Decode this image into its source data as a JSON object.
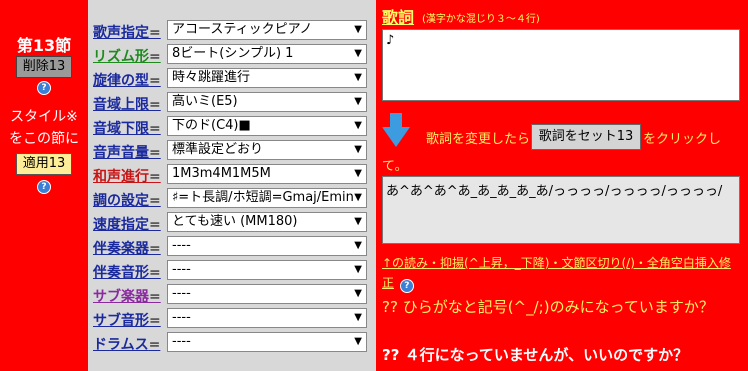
{
  "left": {
    "section_title": "第13節",
    "delete_button": "削除13",
    "style_note_line1": "スタイル※",
    "style_note_line2": "をこの節に",
    "apply_button": "適用13"
  },
  "form": {
    "rows": [
      {
        "label": "歌声指定",
        "value": "アコースティックピアノ"
      },
      {
        "label": "リズム形",
        "value": "8ビート(シンプル) 1"
      },
      {
        "label": "旋律の型",
        "value": "時々跳躍進行"
      },
      {
        "label": "音域上限",
        "value": "高いミ(E5)"
      },
      {
        "label": "音域下限",
        "value": "下のド(C4)■"
      },
      {
        "label": "音声音量",
        "value": "標準設定どおり"
      },
      {
        "label": "和声進行",
        "value": "1M3m4M1M5M"
      },
      {
        "label": "調の設定",
        "value": "♯=ト長調/ホ短調=Gmaj/Emin"
      },
      {
        "label": "速度指定",
        "value": "とても速い (MM180)"
      },
      {
        "label": "伴奏楽器",
        "value": "----"
      },
      {
        "label": "伴奏音形",
        "value": "----"
      },
      {
        "label": "サブ楽器",
        "value": "----"
      },
      {
        "label": "サブ音形",
        "value": "----"
      },
      {
        "label": "ドラムス",
        "value": "----"
      }
    ],
    "eq": "="
  },
  "lyrics": {
    "title": "歌詞",
    "subtitle": "(漢字かな混じり３～４行)",
    "text": "♪",
    "instruction_before": "歌詞を変更したら",
    "set_button": "歌詞をセット13",
    "instruction_after": "をクリックし",
    "instruction_te": "て。",
    "reading_text": "あ^あ^あ^あ_あ_あ_あ_あ/っっっっ/っっっっ/っっっっ/",
    "note": "↑の読み・抑揚(^上昇，_下降)・文節区切り(/)・全角空白挿入修正",
    "warning1": "?? ひらがなと記号(^_/;)のみになっていますか？",
    "warning2": "?? ４行になっていませんが、いいのですか？"
  },
  "colors": {
    "background": "#ff0000",
    "panel": "#d8d8d8",
    "label_blue": "#1a2a9e",
    "label_green": "#1c8a1c",
    "label_red": "#c81414",
    "label_purple": "#8a2aa0",
    "yellow_text": "#ffee66"
  },
  "icons": [
    "help-icon",
    "down-arrow-icon",
    "dropdown-arrow-icon"
  ]
}
